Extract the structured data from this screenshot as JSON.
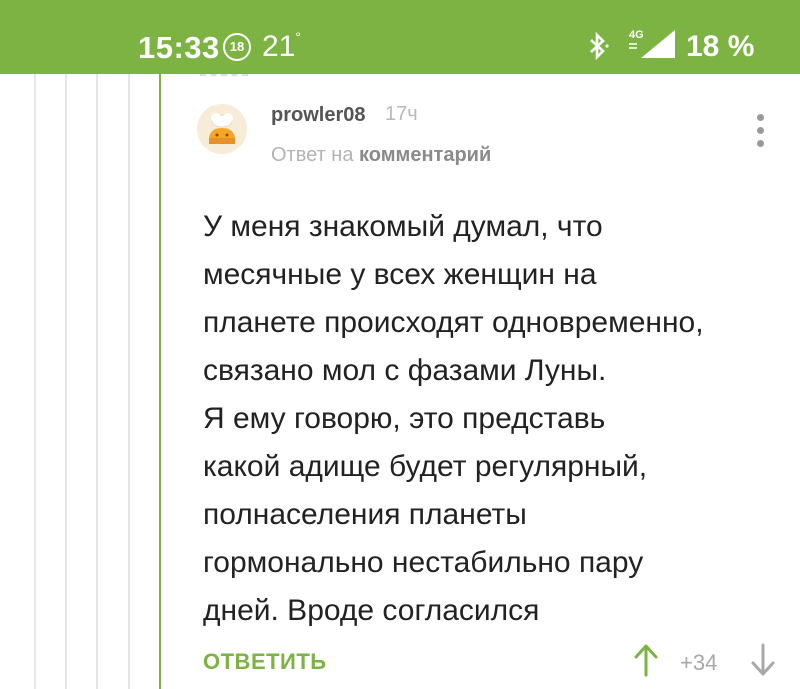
{
  "status_bar": {
    "time": "15:33",
    "notification_badge": "18",
    "temperature": "21",
    "temperature_unit": "°",
    "network": "4G",
    "battery": "18 %",
    "bg_color": "#7cb342"
  },
  "comment": {
    "username": "prowler08",
    "time_ago": "17ч",
    "reply_prefix": "Ответ на",
    "reply_target": "комментарий",
    "lines": [
      "У меня знакомый думал, что",
      "месячные у всех женщин на",
      "планете происходят одновременно,",
      "связано мол с фазами Луны.",
      "Я ему говорю, это представь",
      "какой адище будет регулярный,",
      "полнаселения планеты",
      "гормонально нестабильно пару",
      "дней. Вроде согласился"
    ],
    "reply_label": "ОТВЕТИТЬ",
    "rating": "+34",
    "accent_color": "#7cb342"
  },
  "icons": {
    "more": "more-vertical-icon",
    "upvote": "arrow-up-icon",
    "downvote": "arrow-down-icon",
    "bluetooth": "bluetooth-icon",
    "signal": "signal-icon"
  }
}
